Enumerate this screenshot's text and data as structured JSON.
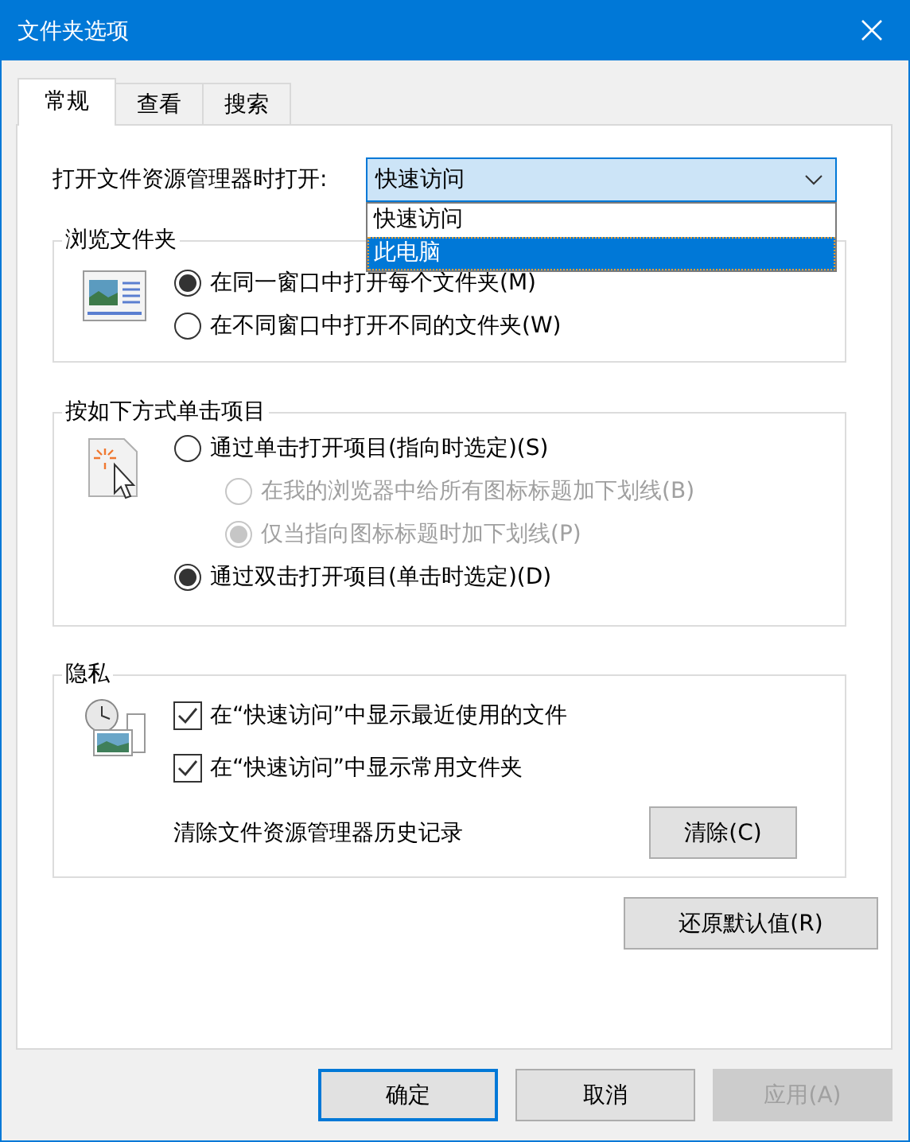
{
  "window": {
    "title": "文件夹选项"
  },
  "tabs": [
    {
      "label": "常规",
      "selected": true
    },
    {
      "label": "查看",
      "selected": false
    },
    {
      "label": "搜索",
      "selected": false
    }
  ],
  "open_with": {
    "label": "打开文件资源管理器时打开:",
    "value": "快速访问",
    "expanded": true,
    "options": [
      {
        "label": "快速访问",
        "highlighted": false
      },
      {
        "label": "此电脑",
        "highlighted": true
      }
    ]
  },
  "groups": [
    {
      "title": "浏览文件夹",
      "items": [
        {
          "kind": "radio",
          "label": "在同一窗口中打开每个文件夹(M)",
          "selected": true,
          "disabled": false
        },
        {
          "kind": "radio",
          "label": "在不同窗口中打开不同的文件夹(W)",
          "selected": false,
          "disabled": false
        }
      ]
    },
    {
      "title": "按如下方式单击项目",
      "items": [
        {
          "kind": "radio",
          "label": "通过单击打开项目(指向时选定)(S)",
          "selected": false,
          "disabled": false,
          "children": [
            {
              "kind": "radio",
              "label": "在我的浏览器中给所有图标标题加下划线(B)",
              "selected": false,
              "disabled": true
            },
            {
              "kind": "radio",
              "label": "仅当指向图标标题时加下划线(P)",
              "selected": true,
              "disabled": true
            }
          ]
        },
        {
          "kind": "radio",
          "label": "通过双击打开项目(单击时选定)(D)",
          "selected": true,
          "disabled": false
        }
      ]
    },
    {
      "title": "隐私",
      "items": [
        {
          "kind": "checkbox",
          "label": "在“快速访问”中显示最近使用的文件",
          "checked": true
        },
        {
          "kind": "checkbox",
          "label": "在“快速访问”中显示常用文件夹",
          "checked": true
        },
        {
          "kind": "action",
          "label": "清除文件资源管理器历史记录",
          "button": "清除(C)"
        }
      ]
    }
  ],
  "restore_button": "还原默认值(R)",
  "buttons": [
    {
      "label": "确定",
      "default": true,
      "disabled": false
    },
    {
      "label": "取消",
      "default": false,
      "disabled": false
    },
    {
      "label": "应用(A)",
      "default": false,
      "disabled": true
    }
  ]
}
